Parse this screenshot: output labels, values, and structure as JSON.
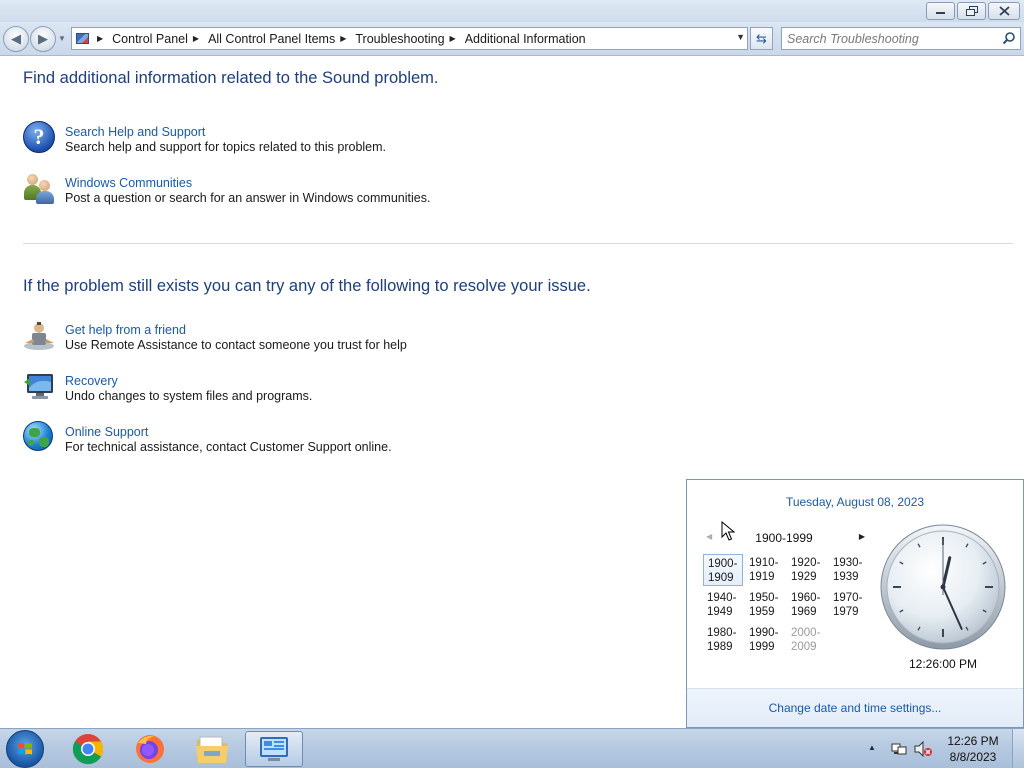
{
  "window": {
    "minimize_icon": "minimize-icon",
    "maximize_icon": "restore-icon",
    "close_icon": "close-icon"
  },
  "navigation": {
    "breadcrumbs": [
      "Control Panel",
      "All Control Panel Items",
      "Troubleshooting",
      "Additional Information"
    ],
    "search_placeholder": "Search Troubleshooting"
  },
  "main": {
    "heading1": "Find additional information related to the Sound problem.",
    "info_items": [
      {
        "title": "Search Help and Support",
        "description": "Search help and support for topics related to this problem.",
        "icon": "help-icon"
      },
      {
        "title": "Windows Communities",
        "description": "Post a question or search for an answer in Windows communities.",
        "icon": "people-icon"
      }
    ],
    "heading2": "If the problem still exists you can try any of the following to resolve your issue.",
    "resolve_items": [
      {
        "title": "Get help from a friend",
        "description": "Use Remote Assistance to contact someone you trust for help",
        "icon": "remote-assistance-icon"
      },
      {
        "title": "Recovery",
        "description": "Undo changes to system files and programs.",
        "icon": "recovery-icon"
      },
      {
        "title": "Online Support",
        "description": "For technical assistance, contact Customer Support online.",
        "icon": "globe-icon"
      }
    ]
  },
  "calendar": {
    "date_header": "Tuesday, August 08, 2023",
    "range_title": "1900-1999",
    "decades": [
      {
        "line1": "1900-",
        "line2": "1909",
        "selected": true,
        "dimmed": false
      },
      {
        "line1": "1910-",
        "line2": "1919",
        "selected": false,
        "dimmed": false
      },
      {
        "line1": "1920-",
        "line2": "1929",
        "selected": false,
        "dimmed": false
      },
      {
        "line1": "1930-",
        "line2": "1939",
        "selected": false,
        "dimmed": false
      },
      {
        "line1": "1940-",
        "line2": "1949",
        "selected": false,
        "dimmed": false
      },
      {
        "line1": "1950-",
        "line2": "1959",
        "selected": false,
        "dimmed": false
      },
      {
        "line1": "1960-",
        "line2": "1969",
        "selected": false,
        "dimmed": false
      },
      {
        "line1": "1970-",
        "line2": "1979",
        "selected": false,
        "dimmed": false
      },
      {
        "line1": "1980-",
        "line2": "1989",
        "selected": false,
        "dimmed": false
      },
      {
        "line1": "1990-",
        "line2": "1999",
        "selected": false,
        "dimmed": false
      },
      {
        "line1": "2000-",
        "line2": "2009",
        "selected": false,
        "dimmed": true
      }
    ],
    "clock_time": "12:26:00 PM",
    "clock": {
      "hour": 12,
      "minute": 26,
      "second": 0
    },
    "footer_link": "Change date and time settings..."
  },
  "taskbar": {
    "apps": [
      "start-orb",
      "chrome-icon",
      "firefox-icon",
      "file-explorer-icon",
      "control-panel-icon"
    ],
    "tray_time": "12:26 PM",
    "tray_date": "8/8/2023"
  }
}
